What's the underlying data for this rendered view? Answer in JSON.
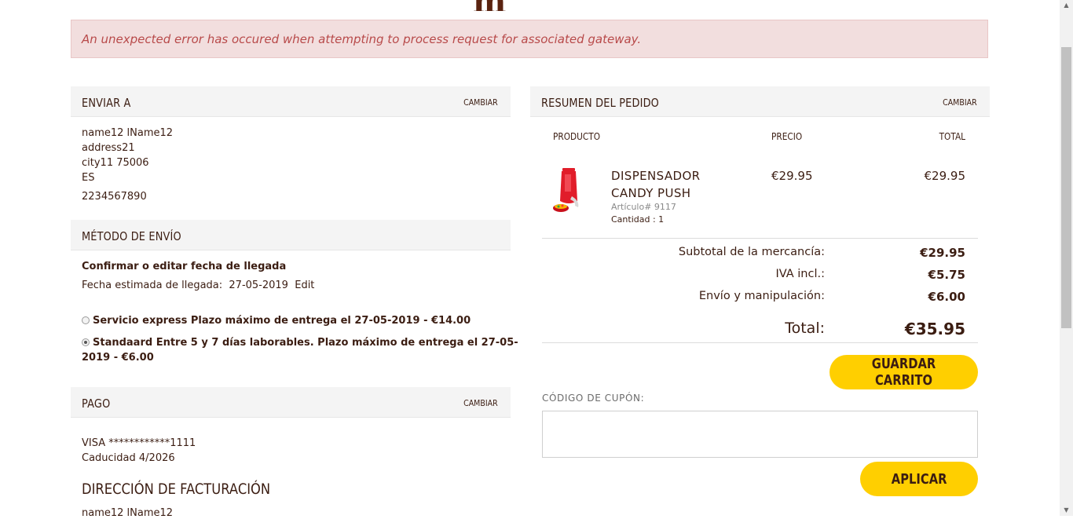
{
  "header": {
    "logo_fragment": "m"
  },
  "error": {
    "message": "An unexpected error has occured when attempting to process request for associated gateway."
  },
  "shipping": {
    "title": "ENVIAR A",
    "change": "CAMBIAR",
    "lines": [
      "name12 lName12",
      "address21",
      "city11 75006",
      "ES"
    ],
    "phone": "2234567890"
  },
  "shipping_method": {
    "title": "MÉTODO DE ENVÍO",
    "confirm_label": "Confirmar o editar fecha de llegada",
    "estimated_label": "Fecha estimada de llegada:",
    "estimated_date": "27-05-2019",
    "edit_label": "Edit",
    "options": [
      {
        "label": "Servicio express Plazo máximo de entrega el 27-05-2019 - €14.00",
        "selected": false
      },
      {
        "label_line1": "Standaard Entre 5 y 7 días laborables. Plazo máximo de entrega el 27-05-",
        "label_line2": "2019 - €6.00",
        "selected": true
      }
    ]
  },
  "payment": {
    "title": "PAGO",
    "change": "CAMBIAR",
    "card": "VISA ************1111",
    "expiry": "Caducidad 4/2026"
  },
  "billing": {
    "title": "DIRECCIÓN DE FACTURACIÓN",
    "first_line": "name12 lName12"
  },
  "order_summary": {
    "title": "RESUMEN DEL PEDIDO",
    "change": "CAMBIAR",
    "columns": {
      "product": "PRODUCTO",
      "price": "PRECIO",
      "total": "TOTAL"
    },
    "items": [
      {
        "name_line1": "DISPENSADOR",
        "name_line2": "CANDY PUSH",
        "article": "Artículo# 9117",
        "quantity": "Cantidad : 1",
        "price": "€29.95",
        "total": "€29.95",
        "image_icon": "candy-dispenser-image"
      }
    ],
    "subtotal_label": "Subtotal de la mercancía:",
    "subtotal_value": "€29.95",
    "vat_label": "IVA incl.:",
    "vat_value": "€5.75",
    "shipping_label": "Envío y manipulación:",
    "shipping_value": "€6.00",
    "total_label": "Total:",
    "total_value": "€35.95"
  },
  "actions": {
    "save_cart": "GUARDAR CARRITO",
    "coupon_label": "CÓDIGO DE CUPÓN:",
    "coupon_placeholder": "",
    "apply": "APLICAR"
  },
  "colors": {
    "accent_yellow": "#ffcf00",
    "brand_brown": "#3b1d12",
    "error_bg": "#f2dede",
    "error_text": "#b84a4a"
  }
}
